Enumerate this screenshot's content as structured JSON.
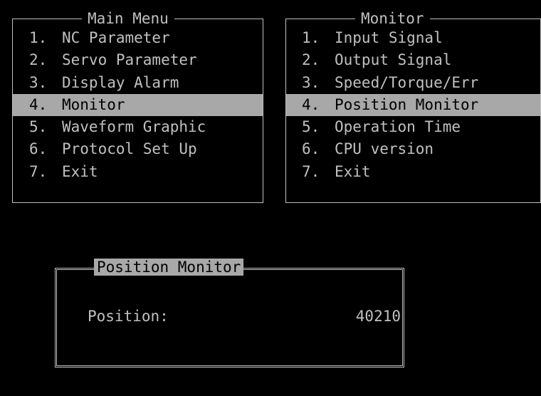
{
  "main_menu": {
    "title": "Main Menu",
    "items": [
      {
        "num": "1.",
        "label": "NC Parameter"
      },
      {
        "num": "2.",
        "label": "Servo Parameter"
      },
      {
        "num": "3.",
        "label": "Display Alarm"
      },
      {
        "num": "4.",
        "label": "Monitor"
      },
      {
        "num": "5.",
        "label": "Waveform Graphic"
      },
      {
        "num": "6.",
        "label": "Protocol Set Up"
      },
      {
        "num": "7.",
        "label": "Exit"
      }
    ],
    "selected_index": 3
  },
  "monitor_menu": {
    "title": "Monitor",
    "items": [
      {
        "num": "1.",
        "label": "Input Signal"
      },
      {
        "num": "2.",
        "label": "Output Signal"
      },
      {
        "num": "3.",
        "label": "Speed/Torque/Err"
      },
      {
        "num": "4.",
        "label": "Position Monitor"
      },
      {
        "num": "5.",
        "label": "Operation Time"
      },
      {
        "num": "6.",
        "label": "CPU version"
      },
      {
        "num": "7.",
        "label": "Exit"
      }
    ],
    "selected_index": 3
  },
  "position_window": {
    "title": "Position Monitor",
    "label": "Position:",
    "value": "40210"
  },
  "colors": {
    "background": "#000000",
    "text": "#c0c0c0",
    "highlight": "#a8a8a8",
    "highlight_text": "#000000"
  }
}
